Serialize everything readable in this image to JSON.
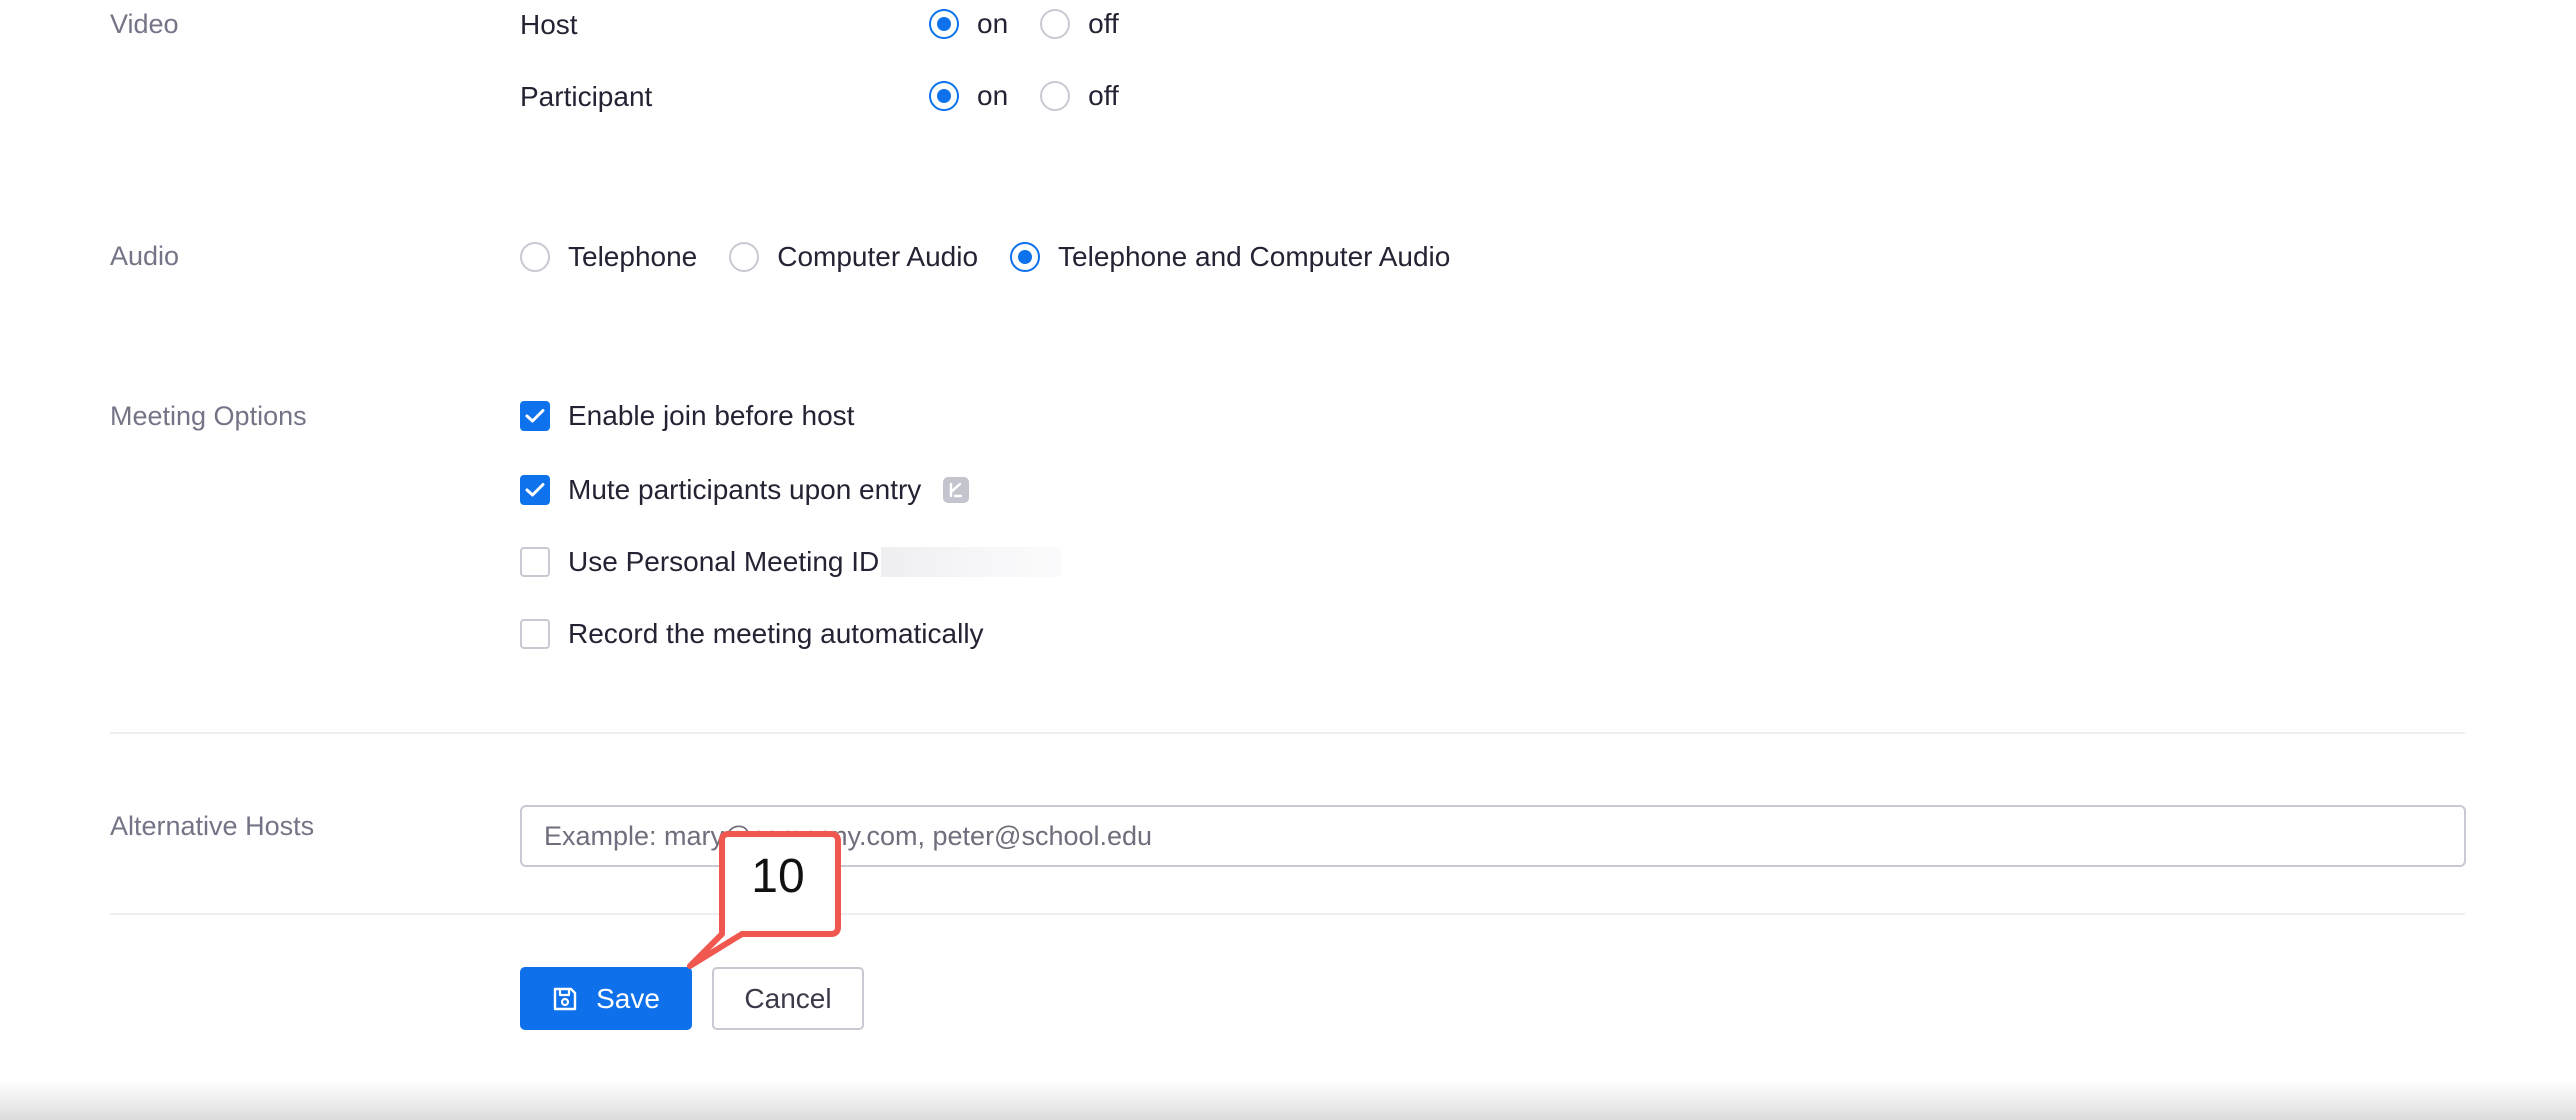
{
  "video": {
    "label": "Video",
    "host_label": "Host",
    "participant_label": "Participant",
    "on_label": "on",
    "off_label": "off",
    "host_value": "on",
    "participant_value": "on"
  },
  "audio": {
    "label": "Audio",
    "options": [
      "Telephone",
      "Computer Audio",
      "Telephone and Computer Audio"
    ],
    "selected": "Telephone and Computer Audio"
  },
  "meeting_options": {
    "label": "Meeting Options",
    "items": [
      {
        "label": "Enable join before host",
        "checked": true
      },
      {
        "label": "Mute participants upon entry",
        "checked": true
      },
      {
        "label": "Use Personal Meeting ID",
        "checked": false
      },
      {
        "label": "Record the meeting automatically",
        "checked": false
      }
    ]
  },
  "alternative_hosts": {
    "label": "Alternative Hosts",
    "placeholder": "Example: mary@company.com, peter@school.edu",
    "value": ""
  },
  "actions": {
    "save_label": "Save",
    "cancel_label": "Cancel"
  },
  "annotation": {
    "label": "10",
    "color": "#f0574f"
  },
  "colors": {
    "accent": "#0e72ed",
    "label_muted": "#747487",
    "text": "#232333",
    "border": "#c9c9d4"
  }
}
